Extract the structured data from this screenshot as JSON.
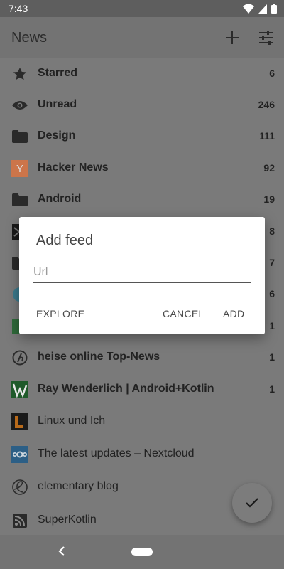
{
  "status_bar": {
    "time": "7:43"
  },
  "app_bar": {
    "title": "News"
  },
  "feeds": [
    {
      "label": "Starred",
      "count": "6",
      "icon": "star-icon",
      "bold": true
    },
    {
      "label": "Unread",
      "count": "246",
      "icon": "eye-icon",
      "bold": true
    },
    {
      "label": "Design",
      "count": "111",
      "icon": "folder-icon",
      "bold": true
    },
    {
      "label": "Hacker News",
      "count": "92",
      "icon": "y-logo-icon",
      "bold": true
    },
    {
      "label": "Android",
      "count": "19",
      "icon": "folder-icon",
      "bold": true
    },
    {
      "label": "",
      "count": "8",
      "icon": "feed-logo-icon",
      "bold": true
    },
    {
      "label": "",
      "count": "7",
      "icon": "folder-icon",
      "bold": true
    },
    {
      "label": "",
      "count": "6",
      "icon": "feed-logo-icon",
      "bold": true
    },
    {
      "label": "",
      "count": "1",
      "icon": "feed-logo-icon",
      "bold": true
    },
    {
      "label": "heise online Top-News",
      "count": "1",
      "icon": "heise-logo-icon",
      "bold": true
    },
    {
      "label": "Ray Wenderlich | Android+Kotlin",
      "count": "1",
      "icon": "rw-logo-icon",
      "bold": true
    },
    {
      "label": "Linux und Ich",
      "count": "",
      "icon": "linux-logo-icon",
      "bold": false
    },
    {
      "label": "The latest updates – Nextcloud",
      "count": "",
      "icon": "nextcloud-logo-icon",
      "bold": false
    },
    {
      "label": "elementary blog",
      "count": "",
      "icon": "elementary-logo-icon",
      "bold": false
    },
    {
      "label": "SuperKotlin",
      "count": "",
      "icon": "rss-icon",
      "bold": false
    }
  ],
  "dialog": {
    "title": "Add feed",
    "url_placeholder": "Url",
    "url_value": "",
    "explore_label": "EXPLORE",
    "cancel_label": "CANCEL",
    "add_label": "ADD"
  },
  "colors": {
    "scrim": "#7a7a7a",
    "dialog_bg": "#ffffff",
    "hn_orange": "#e8743b"
  }
}
